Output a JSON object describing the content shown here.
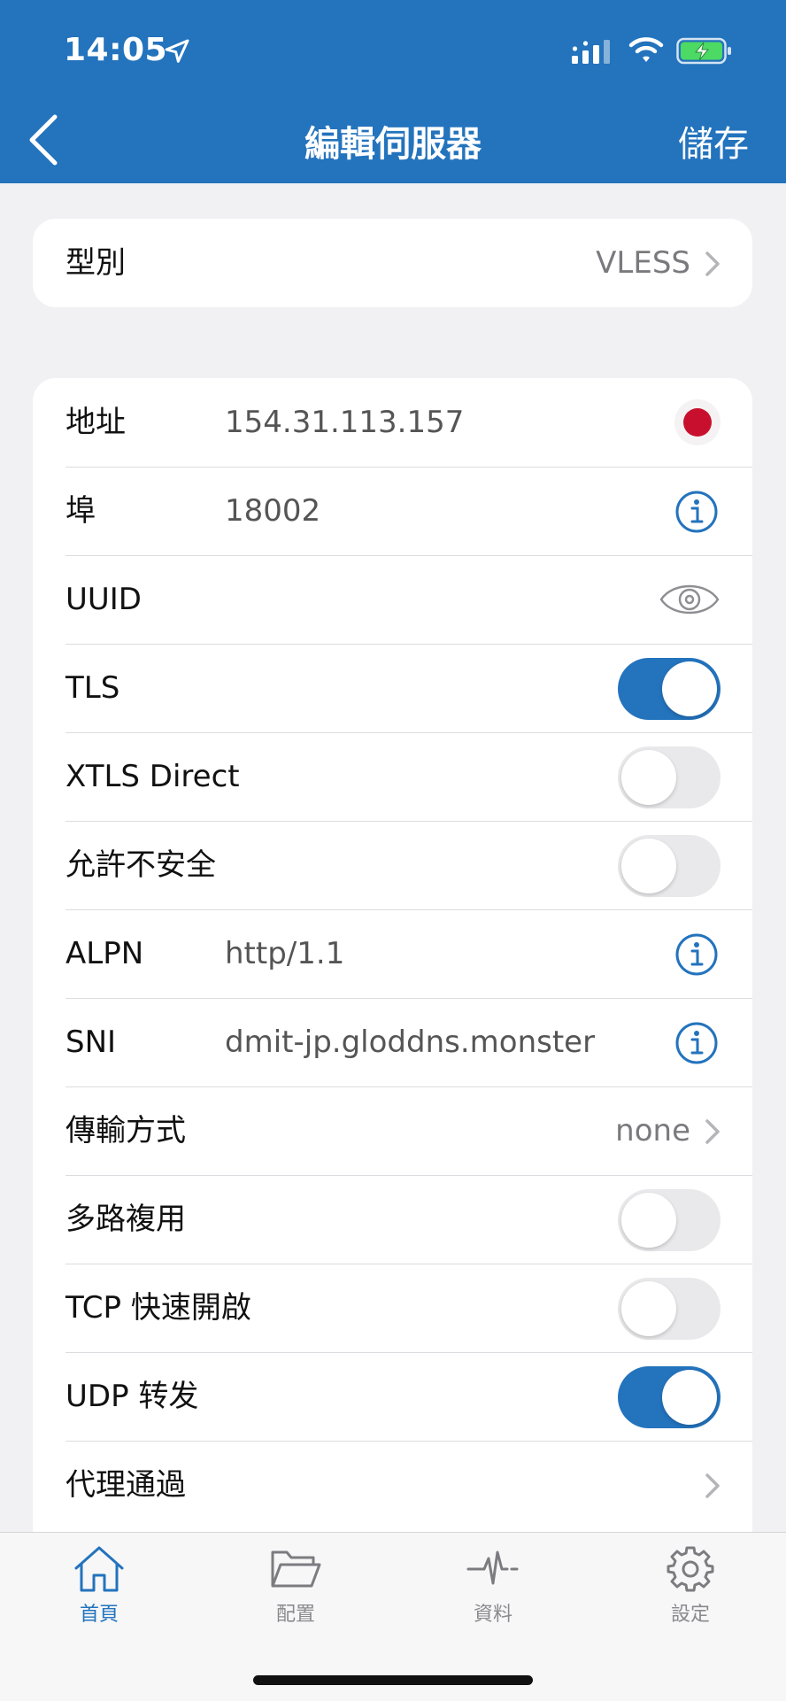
{
  "status_bar": {
    "time": "14:05"
  },
  "nav": {
    "title": "編輯伺服器",
    "save_label": "儲存"
  },
  "type_row": {
    "label": "型別",
    "value": "VLESS"
  },
  "rows": {
    "address": {
      "label": "地址",
      "value": "154.31.113.157"
    },
    "port": {
      "label": "埠",
      "value": "18002"
    },
    "uuid": {
      "label": "UUID"
    },
    "tls": {
      "label": "TLS",
      "on": true
    },
    "xtls": {
      "label": "XTLS Direct",
      "on": false
    },
    "insecure": {
      "label": "允許不安全",
      "on": false
    },
    "alpn": {
      "label": "ALPN",
      "value": "http/1.1"
    },
    "sni": {
      "label": "SNI",
      "value": "dmit-jp.gloddns.monster"
    },
    "transport": {
      "label": "傳輸方式",
      "value": "none"
    },
    "mux": {
      "label": "多路複用",
      "on": false
    },
    "tfo": {
      "label": "TCP 快速開啟",
      "on": false
    },
    "udp": {
      "label": "UDP 转发",
      "on": true
    },
    "proxy_via": {
      "label": "代理通過"
    }
  },
  "tabbar": {
    "tabs": [
      {
        "label": "首頁",
        "icon": "home-icon",
        "active": true
      },
      {
        "label": "配置",
        "icon": "folder-icon",
        "active": false
      },
      {
        "label": "資料",
        "icon": "activity-icon",
        "active": false
      },
      {
        "label": "設定",
        "icon": "gear-icon",
        "active": false
      }
    ]
  },
  "colors": {
    "accent": "#2373bd",
    "background": "#f1f1f3",
    "flag_red": "#c8102e"
  }
}
